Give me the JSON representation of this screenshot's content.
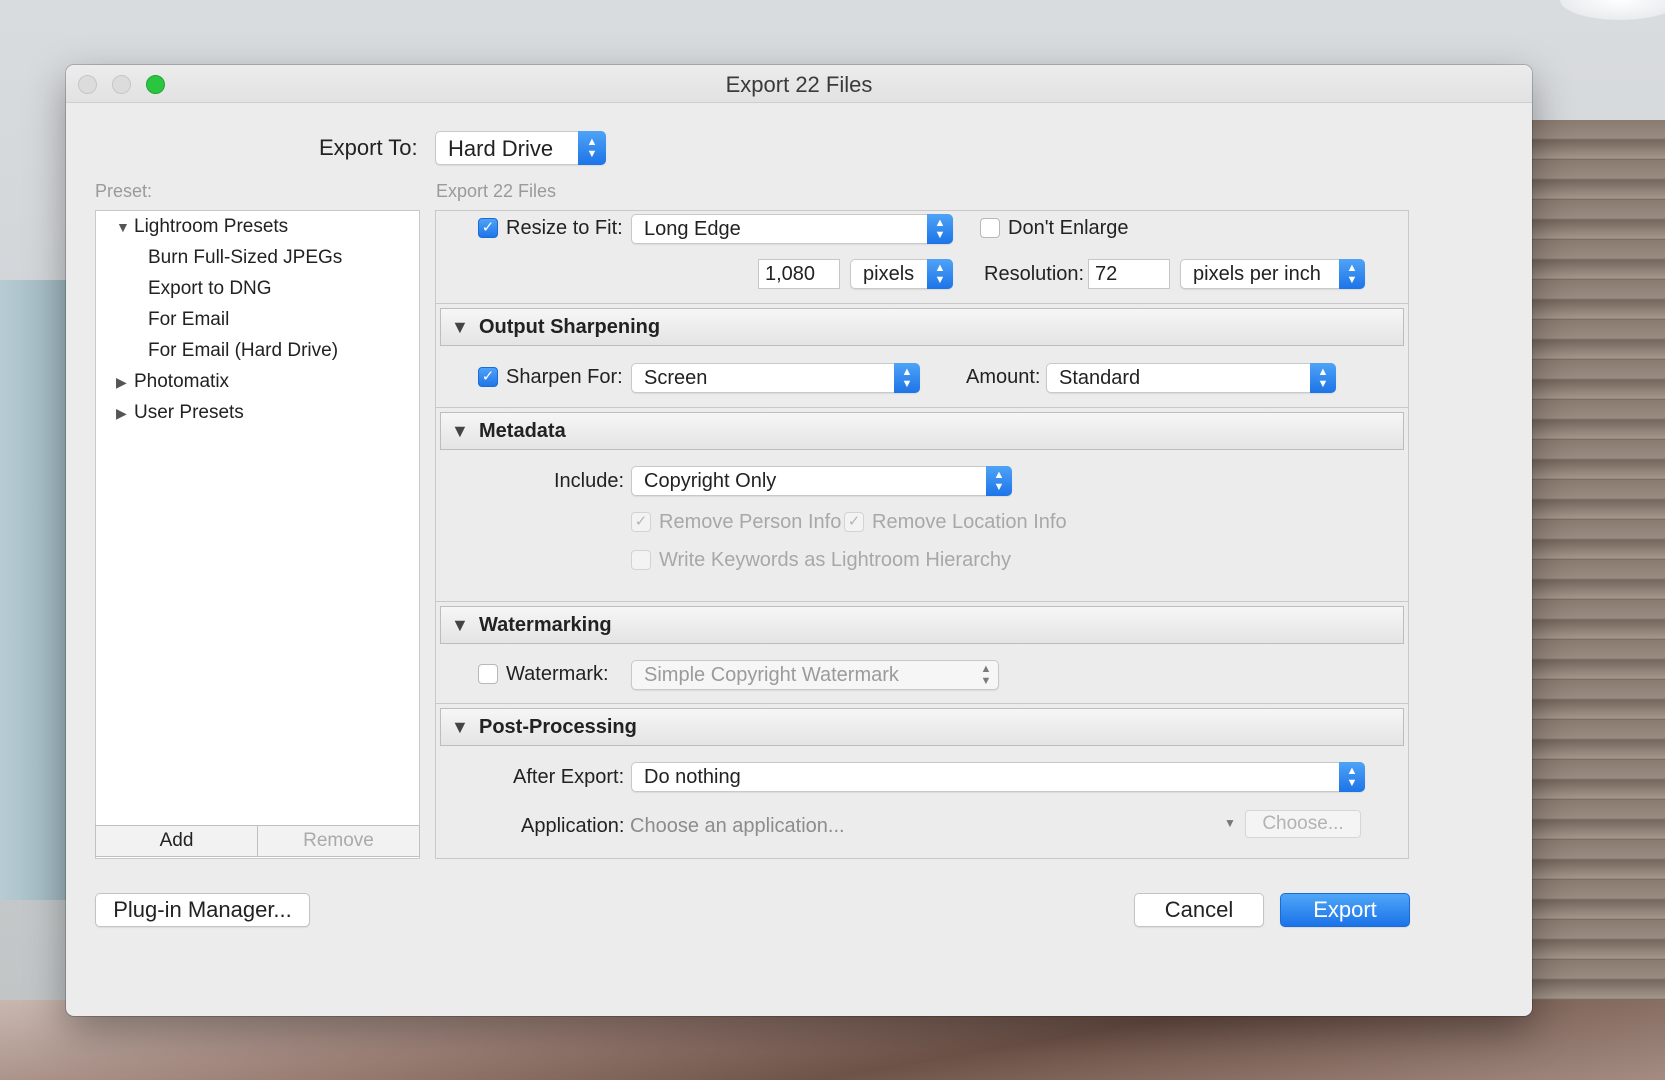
{
  "window": {
    "title": "Export 22 Files"
  },
  "export_to": {
    "label": "Export To:",
    "value": "Hard Drive"
  },
  "preset": {
    "caption": "Preset:",
    "tree": [
      {
        "label": "Lightroom Presets",
        "expanded": true
      },
      {
        "label": "Burn Full-Sized JPEGs"
      },
      {
        "label": "Export to DNG"
      },
      {
        "label": "For Email"
      },
      {
        "label": "For Email (Hard Drive)"
      },
      {
        "label": "Photomatix",
        "expanded": false
      },
      {
        "label": "User Presets",
        "expanded": false
      }
    ],
    "add_label": "Add",
    "remove_label": "Remove"
  },
  "settings_caption": "Export 22 Files",
  "image_sizing": {
    "resize_checked": true,
    "resize_label": "Resize to Fit:",
    "resize_mode": "Long Edge",
    "dont_enlarge_checked": false,
    "dont_enlarge_label": "Don't Enlarge",
    "size_value": "1,080",
    "size_unit": "pixels",
    "resolution_label": "Resolution:",
    "resolution_value": "72",
    "resolution_unit": "pixels per inch"
  },
  "output_sharpening": {
    "title": "Output Sharpening",
    "sharpen_checked": true,
    "sharpen_label": "Sharpen For:",
    "sharpen_for": "Screen",
    "amount_label": "Amount:",
    "amount": "Standard"
  },
  "metadata": {
    "title": "Metadata",
    "include_label": "Include:",
    "include": "Copyright Only",
    "remove_person_label": "Remove Person Info",
    "remove_person_checked": true,
    "remove_location_label": "Remove Location Info",
    "remove_location_checked": true,
    "keywords_label": "Write Keywords as Lightroom Hierarchy",
    "keywords_checked": false
  },
  "watermarking": {
    "title": "Watermarking",
    "watermark_checked": false,
    "watermark_label": "Watermark:",
    "watermark_style": "Simple Copyright Watermark"
  },
  "post_processing": {
    "title": "Post-Processing",
    "after_export_label": "After Export:",
    "after_export": "Do nothing",
    "application_label": "Application:",
    "application_placeholder": "Choose an application...",
    "choose_label": "Choose..."
  },
  "footer": {
    "plugin_manager_label": "Plug-in Manager...",
    "cancel_label": "Cancel",
    "export_label": "Export"
  },
  "colors": {
    "accent": "#1e76e9",
    "traffic_green": "#2bc53f"
  }
}
